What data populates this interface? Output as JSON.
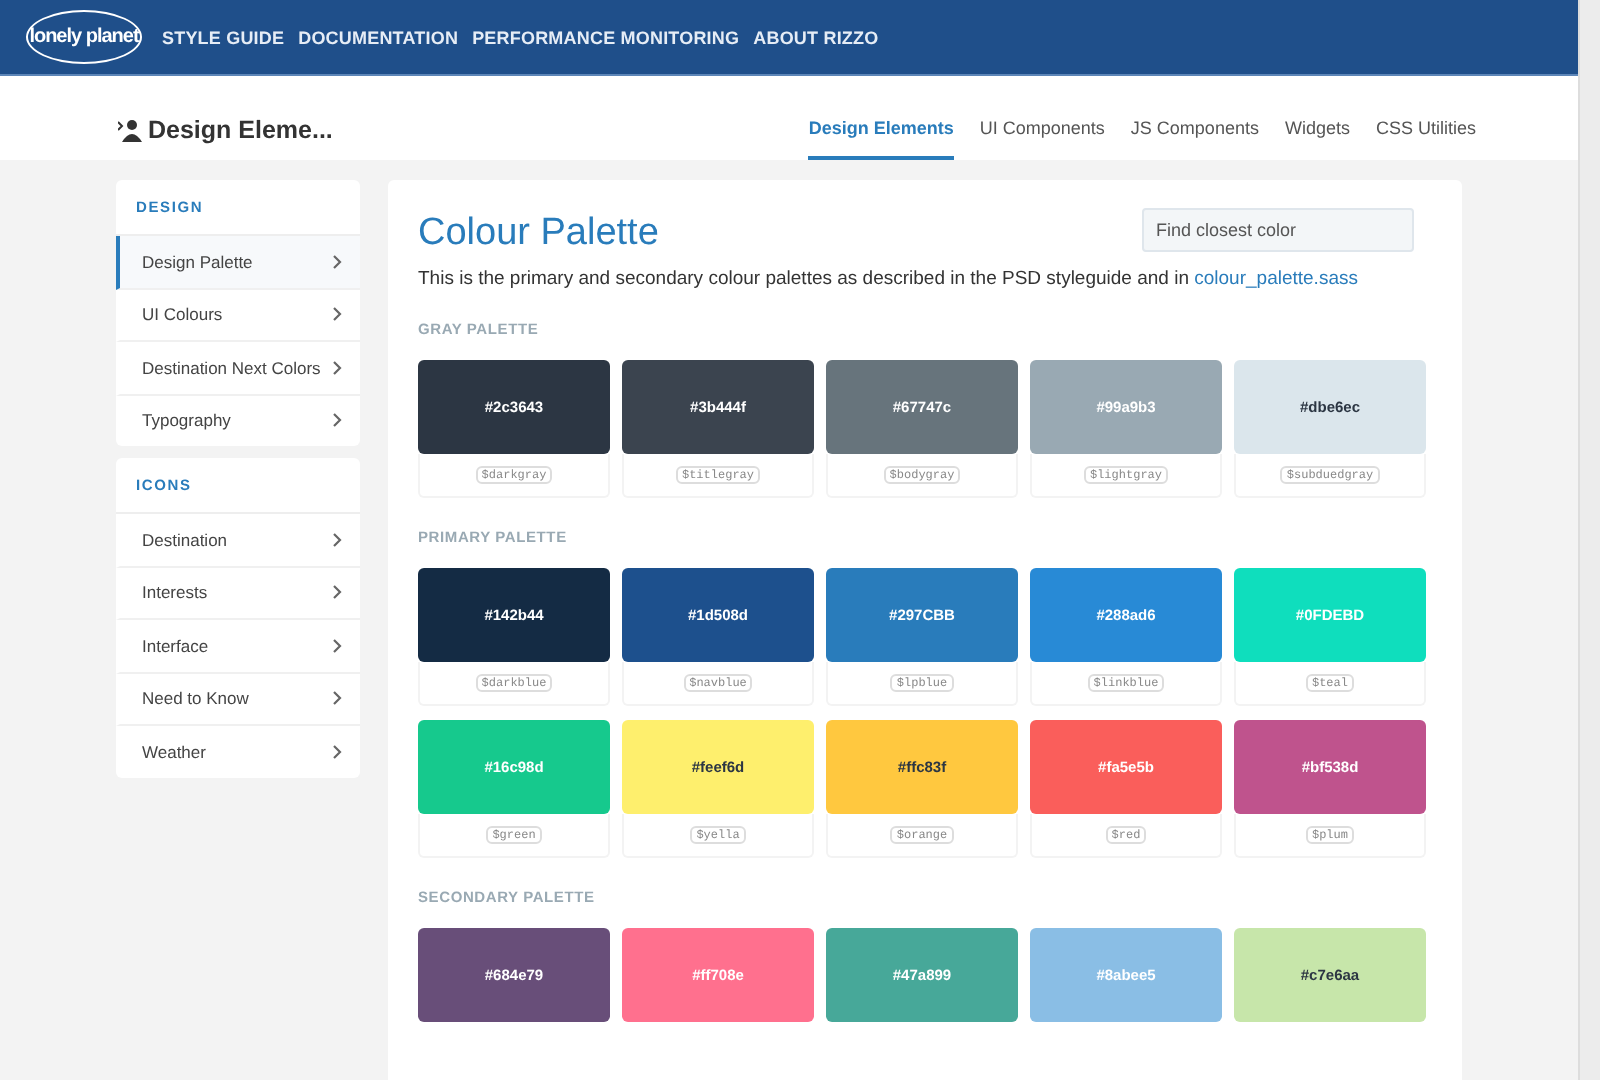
{
  "header": {
    "logo": "lonely planet",
    "nav": [
      "STYLE GUIDE",
      "DOCUMENTATION",
      "PERFORMANCE MONITORING",
      "ABOUT RIZZO"
    ]
  },
  "subheader": {
    "title": "Design Eleme...",
    "tabs": [
      {
        "label": "Design Elements",
        "selected": true
      },
      {
        "label": "UI Components",
        "selected": false
      },
      {
        "label": "JS Components",
        "selected": false
      },
      {
        "label": "Widgets",
        "selected": false
      },
      {
        "label": "CSS Utilities",
        "selected": false
      }
    ]
  },
  "sidebar": [
    {
      "heading": "DESIGN",
      "items": [
        {
          "label": "Design Palette",
          "selected": true
        },
        {
          "label": "UI Colours",
          "selected": false
        },
        {
          "label": "Destination Next Colors",
          "selected": false
        },
        {
          "label": "Typography",
          "selected": false
        }
      ]
    },
    {
      "heading": "ICONS",
      "items": [
        {
          "label": "Destination",
          "selected": false
        },
        {
          "label": "Interests",
          "selected": false
        },
        {
          "label": "Interface",
          "selected": false
        },
        {
          "label": "Need to Know",
          "selected": false
        },
        {
          "label": "Weather",
          "selected": false
        }
      ]
    }
  ],
  "main": {
    "title": "Colour Palette",
    "search": {
      "placeholder": "Find closest color"
    },
    "description": "This is the primary and secondary colour palettes as described in the PSD styleguide and in ",
    "description_link": "colour_palette.sass",
    "palettes": [
      {
        "heading": "GRAY PALETTE",
        "swatches": [
          {
            "hex": "#2c3643",
            "color": "#2c3643",
            "variable": "$darkgray"
          },
          {
            "hex": "#3b444f",
            "color": "#3b444f",
            "variable": "$titlegray"
          },
          {
            "hex": "#67747c",
            "color": "#67747c",
            "variable": "$bodygray"
          },
          {
            "hex": "#99a9b3",
            "color": "#99a9b3",
            "variable": "$lightgray"
          },
          {
            "hex": "#dbe6ec",
            "color": "#dbe6ec",
            "variable": "$subduedgray"
          }
        ]
      },
      {
        "heading": "PRIMARY PALETTE",
        "swatches": [
          {
            "hex": "#142b44",
            "color": "#142b44",
            "variable": "$darkblue"
          },
          {
            "hex": "#1d508d",
            "color": "#1d508d",
            "variable": "$navblue"
          },
          {
            "hex": "#297CBB",
            "color": "#297cbb",
            "variable": "$lpblue"
          },
          {
            "hex": "#288ad6",
            "color": "#288ad6",
            "variable": "$linkblue"
          },
          {
            "hex": "#0FDEBD",
            "color": "#0fdebd",
            "variable": "$teal"
          },
          {
            "hex": "#16c98d",
            "color": "#16c98d",
            "variable": "$green"
          },
          {
            "hex": "#feef6d",
            "color": "#feef6d",
            "variable": "$yella"
          },
          {
            "hex": "#ffc83f",
            "color": "#ffc83f",
            "variable": "$orange"
          },
          {
            "hex": "#fa5e5b",
            "color": "#fa5e5b",
            "variable": "$red"
          },
          {
            "hex": "#bf538d",
            "color": "#bf538d",
            "variable": "$plum"
          }
        ]
      },
      {
        "heading": "SECONDARY PALETTE",
        "swatches": [
          {
            "hex": "#684e79",
            "color": "#684e79"
          },
          {
            "hex": "#ff708e",
            "color": "#ff708e"
          },
          {
            "hex": "#47a899",
            "color": "#47a899"
          },
          {
            "hex": "#8abee5",
            "color": "#8abee5"
          },
          {
            "hex": "#c7e6aa",
            "color": "#c7e6aa"
          }
        ]
      }
    ]
  }
}
